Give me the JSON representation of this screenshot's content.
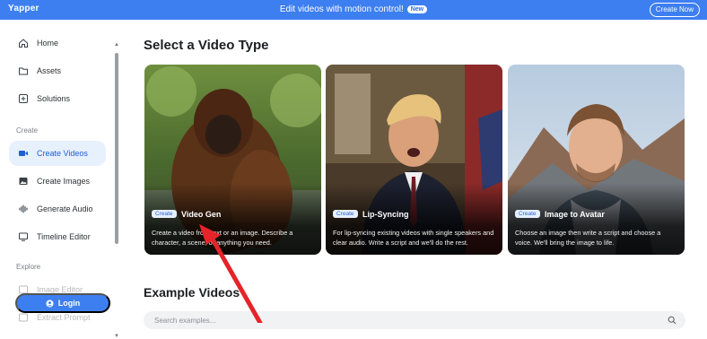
{
  "topbar": {
    "brand": "Yapper",
    "announcement": "Edit videos with motion control!",
    "badge": "New",
    "cta": "Create Now"
  },
  "sidebar": {
    "items_top": [
      {
        "label": "Home",
        "icon": "home-icon"
      },
      {
        "label": "Assets",
        "icon": "folder-icon"
      },
      {
        "label": "Solutions",
        "icon": "plus-square-icon"
      }
    ],
    "section_create": "Create",
    "items_create": [
      {
        "label": "Create Videos",
        "icon": "video-icon",
        "active": true
      },
      {
        "label": "Create Images",
        "icon": "image-icon"
      },
      {
        "label": "Generate Audio",
        "icon": "audio-wave-icon"
      },
      {
        "label": "Timeline Editor",
        "icon": "monitor-icon"
      }
    ],
    "section_explore": "Explore",
    "items_explore": [
      {
        "label": "Image Editor"
      },
      {
        "label": "Extract Prompt"
      }
    ],
    "login": "Login"
  },
  "main": {
    "title": "Select a Video Type",
    "cards": [
      {
        "tag": "Create",
        "title": "Video Gen",
        "desc": "Create a video from text or an image. Describe a character, a scene, or anything you need."
      },
      {
        "tag": "Create",
        "title": "Lip-Syncing",
        "desc": "For lip-syncing existing videos with single speakers and clear audio. Write a script and we'll do the rest."
      },
      {
        "tag": "Create",
        "title": "Image to Avatar",
        "desc": "Choose an image then write a script and choose a voice. We'll bring the image to life."
      }
    ],
    "examples_title": "Example Videos",
    "search_placeholder": "Search examples..."
  },
  "colors": {
    "accent": "#3d7ff0",
    "active_bg": "#e7f0fd",
    "arrow": "#e5242a"
  }
}
